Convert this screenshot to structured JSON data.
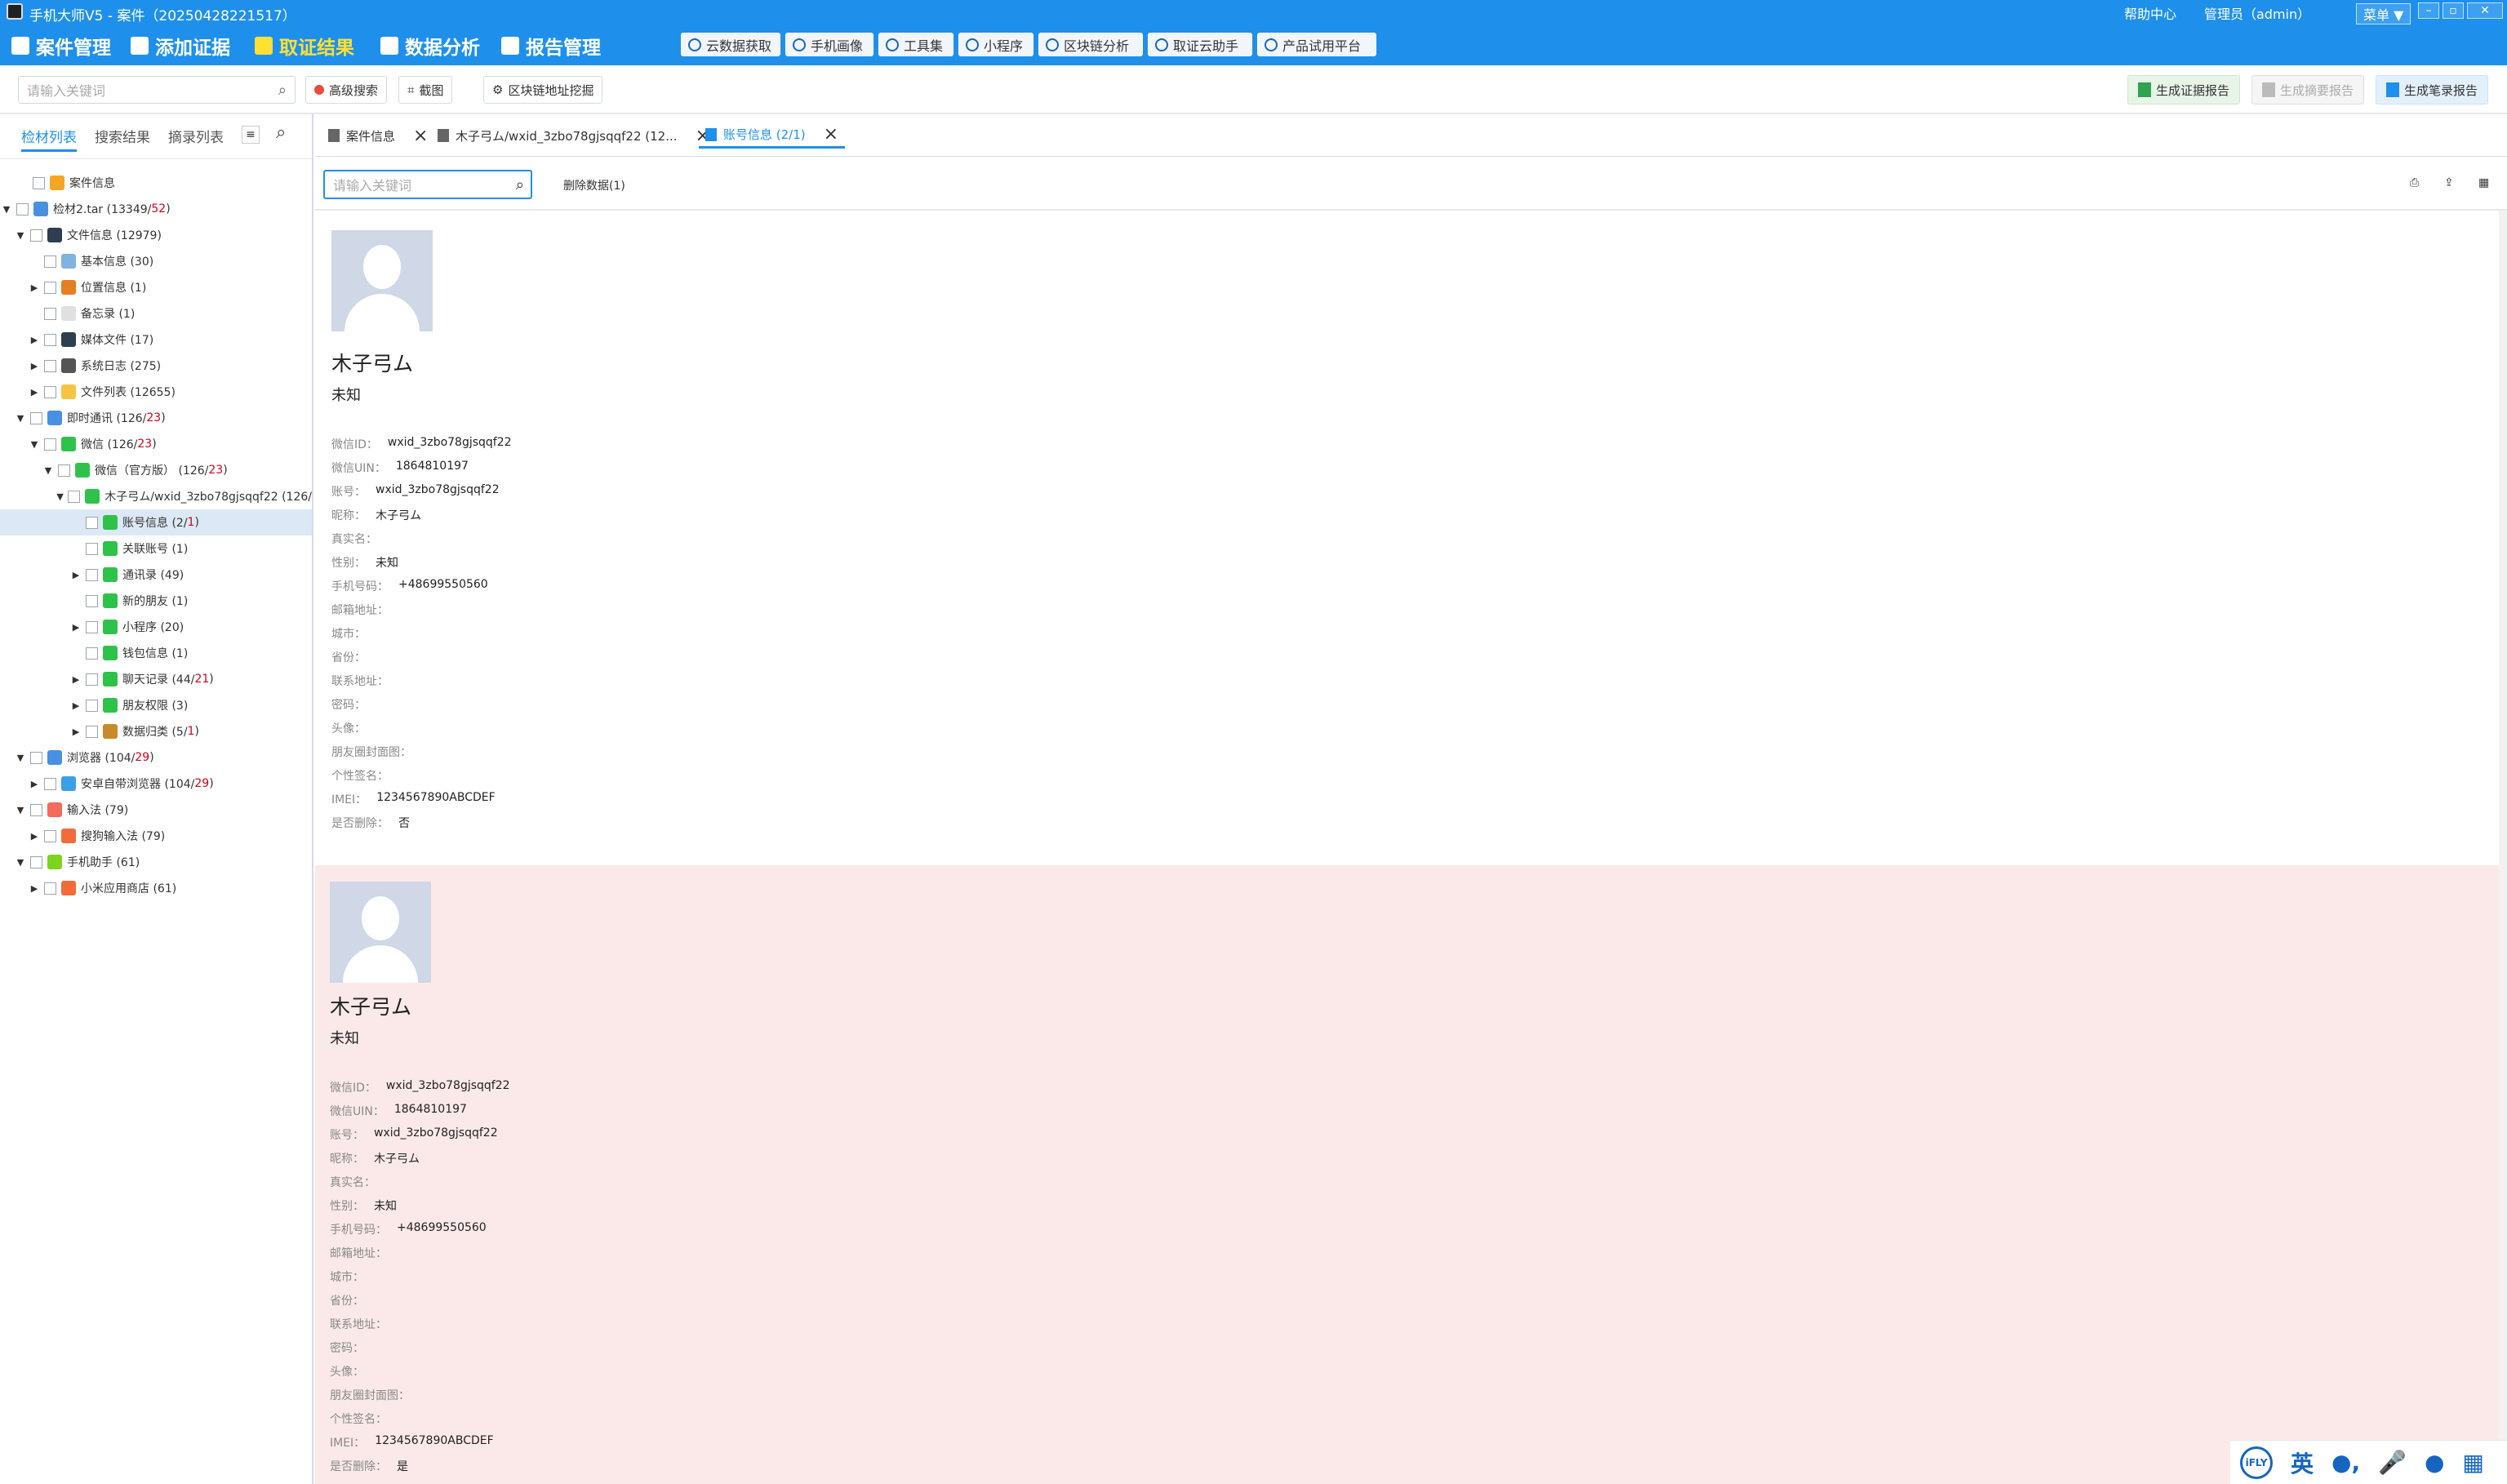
{
  "titlebar": {
    "title": "手机大师V5 - 案件（20250428221517）",
    "help": "帮助中心",
    "user": "管理员（admin）",
    "menu": "菜单 ▼"
  },
  "nav": {
    "items": [
      {
        "label": "案件管理",
        "icon": "case-icon"
      },
      {
        "label": "添加证据",
        "icon": "add-evidence-icon"
      },
      {
        "label": "取证结果",
        "icon": "result-icon"
      },
      {
        "label": "数据分析",
        "icon": "analysis-icon"
      },
      {
        "label": "报告管理",
        "icon": "report-icon"
      }
    ],
    "tools": [
      "云数据获取",
      "手机画像",
      "工具集",
      "小程序",
      "区块链分析",
      "取证云助手",
      "产品试用平台"
    ]
  },
  "toolbar": {
    "search_placeholder": "请输入关键词",
    "advanced": "高级搜索",
    "screenshot": "截图",
    "blockchain": "区块链地址挖掘",
    "gen_evidence": "生成证据报告",
    "gen_summary": "生成摘要报告",
    "gen_record": "生成笔录报告"
  },
  "left": {
    "tabs": [
      "检材列表",
      "搜索结果",
      "摘录列表"
    ],
    "tree": [
      {
        "label": "案件信息",
        "count": "",
        "red": "",
        "icolor": "#f5a623"
      },
      {
        "label": "检材2.tar (13349/",
        "count": "",
        "red": "52",
        "tail": ")",
        "icolor": "#4a90e2"
      },
      {
        "label": "文件信息 (12979)",
        "count": "",
        "red": "",
        "icolor": "#2c3e50"
      },
      {
        "label": "基本信息 (30)",
        "count": "",
        "red": "",
        "icolor": "#7fb3e0"
      },
      {
        "label": "位置信息 (1)",
        "count": "",
        "red": "",
        "icolor": "#e67e22"
      },
      {
        "label": "备忘录 (1)",
        "count": "",
        "red": "",
        "icolor": "#e0e0e0"
      },
      {
        "label": "媒体文件 (17)",
        "count": "",
        "red": "",
        "icolor": "#2c3e50"
      },
      {
        "label": "系统日志 (275)",
        "count": "",
        "red": "",
        "icolor": "#555"
      },
      {
        "label": "文件列表 (12655)",
        "count": "",
        "red": "",
        "icolor": "#f5c542"
      },
      {
        "label": "即时通讯 (126/",
        "count": "",
        "red": "23",
        "tail": ")",
        "icolor": "#4a90e2"
      },
      {
        "label": "微信 (126/",
        "count": "",
        "red": "23",
        "tail": ")",
        "icolor": "#2ec24b"
      },
      {
        "label": "微信（官方版） (126/",
        "count": "",
        "red": "23",
        "tail": ")",
        "icolor": "#2ec24b"
      },
      {
        "label": "木子弓ム/wxid_3zbo78gjsqqf22 (126/",
        "count": "",
        "red": "",
        "icolor": "#2ec24b"
      },
      {
        "label": "账号信息 (2/",
        "count": "",
        "red": "1",
        "tail": ")",
        "icolor": "#2ec24b"
      },
      {
        "label": "关联账号 (1)",
        "count": "",
        "red": "",
        "icolor": "#2ec24b"
      },
      {
        "label": "通讯录 (49)",
        "count": "",
        "red": "",
        "icolor": "#2ec24b"
      },
      {
        "label": "新的朋友 (1)",
        "count": "",
        "red": "",
        "icolor": "#2ec24b"
      },
      {
        "label": "小程序 (20)",
        "count": "",
        "red": "",
        "icolor": "#2ec24b"
      },
      {
        "label": "钱包信息 (1)",
        "count": "",
        "red": "",
        "icolor": "#2ec24b"
      },
      {
        "label": "聊天记录 (44/",
        "count": "",
        "red": "21",
        "tail": ")",
        "icolor": "#2ec24b"
      },
      {
        "label": "朋友权限 (3)",
        "count": "",
        "red": "",
        "icolor": "#2ec24b"
      },
      {
        "label": "数据归类 (5/",
        "count": "",
        "red": "1",
        "tail": ")",
        "icolor": "#c8892c"
      },
      {
        "label": "浏览器 (104/",
        "count": "",
        "red": "29",
        "tail": ")",
        "icolor": "#4a90e2"
      },
      {
        "label": "安卓自带浏览器 (104/",
        "count": "",
        "red": "29",
        "tail": ")",
        "icolor": "#3aa0e8"
      },
      {
        "label": "输入法 (79)",
        "count": "",
        "red": "",
        "icolor": "#f26b5b"
      },
      {
        "label": "搜狗输入法 (79)",
        "count": "",
        "red": "",
        "icolor": "#f26b3a"
      },
      {
        "label": "手机助手 (61)",
        "count": "",
        "red": "",
        "icolor": "#7ed321"
      },
      {
        "label": "小米应用商店 (61)",
        "count": "",
        "red": "",
        "icolor": "#f26b3a"
      }
    ]
  },
  "content": {
    "tabs": [
      "案件信息",
      "木子弓ム/wxid_3zbo78gjsqqf22 (12...",
      "账号信息 (2/1)"
    ],
    "filter_placeholder": "请输入关键词",
    "deleted_label": "删除数据(1)",
    "records": [
      {
        "name": "木子弓ム",
        "gender": "未知",
        "fields": [
          {
            "k": "微信ID：",
            "v": "wxid_3zbo78gjsqqf22"
          },
          {
            "k": "微信UIN：",
            "v": "1864810197"
          },
          {
            "k": "账号：",
            "v": "wxid_3zbo78gjsqqf22"
          },
          {
            "k": "昵称：",
            "v": "木子弓ム"
          },
          {
            "k": "真实名：",
            "v": ""
          },
          {
            "k": "性别：",
            "v": "未知"
          },
          {
            "k": "手机号码：",
            "v": "+48699550560"
          },
          {
            "k": "邮箱地址：",
            "v": ""
          },
          {
            "k": "城市：",
            "v": ""
          },
          {
            "k": "省份：",
            "v": ""
          },
          {
            "k": "联系地址：",
            "v": ""
          },
          {
            "k": "密码：",
            "v": ""
          },
          {
            "k": "头像：",
            "v": ""
          },
          {
            "k": "朋友圈封面图：",
            "v": ""
          },
          {
            "k": "个性签名：",
            "v": ""
          },
          {
            "k": "IMEI：",
            "v": "1234567890ABCDEF"
          },
          {
            "k": "是否删除：",
            "v": "否"
          }
        ]
      },
      {
        "name": "木子弓ム",
        "gender": "未知",
        "fields": [
          {
            "k": "微信ID：",
            "v": "wxid_3zbo78gjsqqf22"
          },
          {
            "k": "微信UIN：",
            "v": "1864810197"
          },
          {
            "k": "账号：",
            "v": "wxid_3zbo78gjsqqf22"
          },
          {
            "k": "昵称：",
            "v": "木子弓ム"
          },
          {
            "k": "真实名：",
            "v": ""
          },
          {
            "k": "性别：",
            "v": "未知"
          },
          {
            "k": "手机号码：",
            "v": "+48699550560"
          },
          {
            "k": "邮箱地址：",
            "v": ""
          },
          {
            "k": "城市：",
            "v": ""
          },
          {
            "k": "省份：",
            "v": ""
          },
          {
            "k": "联系地址：",
            "v": ""
          },
          {
            "k": "密码：",
            "v": ""
          },
          {
            "k": "头像：",
            "v": ""
          },
          {
            "k": "朋友圈封面图：",
            "v": ""
          },
          {
            "k": "个性签名：",
            "v": ""
          },
          {
            "k": "IMEI：",
            "v": "1234567890ABCDEF"
          },
          {
            "k": "是否删除：",
            "v": "是"
          }
        ]
      }
    ]
  },
  "ime": {
    "logo": "iFLY",
    "lang": "英"
  },
  "colors": {
    "primary": "#1e90ec",
    "deleted_bg": "#fbe9e9",
    "selected_row": "#dde8f6",
    "red_count": "#d0021b",
    "active_nav": "#ffe033"
  }
}
